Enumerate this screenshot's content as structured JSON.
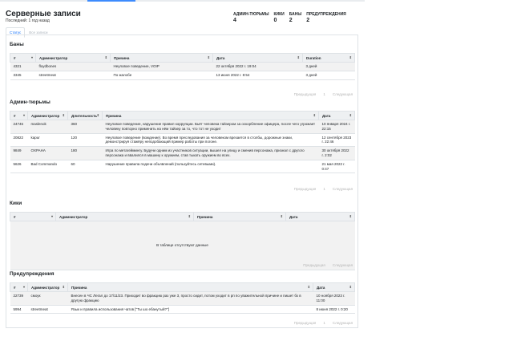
{
  "header": {
    "title": "Серверные записи",
    "subtitle": "Последний: 1 год назад"
  },
  "stats": [
    {
      "label": "АДМИН-ТЮРЬМЫ",
      "value": "4"
    },
    {
      "label": "КИКИ",
      "value": "0"
    },
    {
      "label": "БАНЫ",
      "value": "2"
    },
    {
      "label": "ПРЕДУПРЕЖДЕНИЯ",
      "value": "2"
    }
  ],
  "tabs": [
    {
      "label": "Статус",
      "active": true
    },
    {
      "label": "Все записи",
      "active": false
    }
  ],
  "pager": {
    "prev": "Предыдущая",
    "page": "1",
    "next": "Следующая"
  },
  "bans": {
    "title": "Баны",
    "columns": [
      "#",
      "Администратор",
      "Причина",
      "Дата",
      "Duration"
    ],
    "rows": [
      [
        "4321",
        "floydbones",
        "Неуловое поведение, VOIP",
        "22 октября 2022 г. 19:04",
        "3 дней"
      ],
      [
        "3345",
        "streetmeat",
        "По жалобе",
        "13 июня 2022 г. 8:54",
        "3 дней"
      ]
    ]
  },
  "jails": {
    "title": "Админ-тюрьмы",
    "columns": [
      "#",
      "Администратор",
      "Длительность",
      "Причина",
      "Дата"
    ],
    "rows": [
      [
        "24746",
        "maslenok",
        "360",
        "Неуловое поведение, нарушение правил коррупции. Бьёт человека тайзером за оскорбление офицера, после чего угрожает человеку повторно применить на нём тайзер за то, что тот не уходит",
        "10 января 2024 г. 22:15"
      ],
      [
        "20822",
        "kapur",
        "120",
        "Неуловое поведение (вождение). Во время преследования за человеком врезается в столбы, дорожные знаки, демонстрируя стажёру неподобающий пример работы при погоне.",
        "12 сентября 2023 г. 22:46"
      ],
      [
        "9849",
        "OXPAHA",
        "180",
        "Игра по метагеймингу. Будучи одним из участников ситуации, вышел на улицу и сменив персонажа, признал с другого персонажа и ввалился в машину к оружием, став тыкать оружием во всех.",
        "30 октября 2022 г. 2:02"
      ],
      [
        "5626",
        "Bad Commando",
        "60",
        "Нарушение правила подачи объявлений (пользуйтесь сетевыми).",
        "21 мая 2022 г. 0:47"
      ]
    ]
  },
  "kicks": {
    "title": "Кики",
    "columns": [
      "#",
      "Администратор",
      "Причина",
      "Дата"
    ],
    "empty": "В таблице отсутствуют данные"
  },
  "warnings": {
    "title": "Предупреждения",
    "columns": [
      "#",
      "Администратор",
      "Причина",
      "Дата"
    ],
    "rows": [
      [
        "22739",
        "смоук",
        "Внесен в ЧС Легал до 17/11/23. Приходит во фракцию раз уже 3, просто сидит, потом уходит в рп по уважительной причине и пишет бх в другую фракцию",
        "10 ноября 2023 г. 11:00"
      ],
      [
        "5994",
        "streetmeat",
        "Язык и правила использования чатов [\"Ты шо ебанутый?\"]",
        "8 июня 2022 г. 0:20"
      ]
    ]
  }
}
